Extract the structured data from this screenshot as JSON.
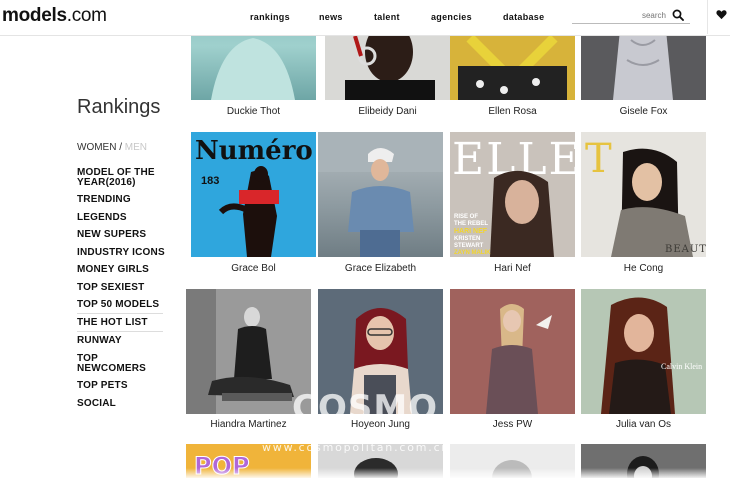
{
  "header": {
    "logo_main": "models",
    "logo_suffix": ".com",
    "nav": [
      "rankings",
      "news",
      "talent",
      "agencies",
      "database"
    ],
    "search_placeholder": "search"
  },
  "sidebar": {
    "title": "Rankings",
    "gender_women": "WOMEN",
    "gender_sep": " / ",
    "gender_men": "MEN",
    "items": [
      "MODEL OF THE YEAR(2016)",
      "TRENDING",
      "LEGENDS",
      "NEW SUPERS",
      "INDUSTRY ICONS",
      "MONEY GIRLS",
      "TOP SEXIEST",
      "TOP 50 MODELS",
      "THE HOT LIST",
      "RUNWAY",
      "TOP NEWCOMERS",
      "TOP PETS",
      "SOCIAL"
    ]
  },
  "models": {
    "row1": [
      "Duckie Thot",
      "Elibeidy Dani",
      "Ellen Rosa",
      "Gisele Fox"
    ],
    "row2": [
      "Grace Bol",
      "Grace Elizabeth",
      "Hari Nef",
      "He Cong"
    ],
    "row3": [
      "Hiandra Martinez",
      "Hoyeon Jung",
      "Jess PW",
      "Julia van Os"
    ]
  },
  "covers": {
    "numero_title": "Numéro",
    "numero_issue": "183",
    "elle_title": "ELLE",
    "elle_lines": [
      "RISE OF",
      "THE REBEL",
      "HARI NEF",
      "KRISTEN",
      "STEWART",
      "ZAYN MALIK"
    ],
    "vogue_letter": "T",
    "beauty": "BEAUTY",
    "calvin": "Calvin Klein",
    "pop": "POP"
  },
  "watermark": {
    "logo": "COSMO",
    "url": "www.cosmopolitan.com.cn"
  },
  "colors": {
    "accent": "#111111",
    "men_inactive": "#c8c8c8"
  }
}
